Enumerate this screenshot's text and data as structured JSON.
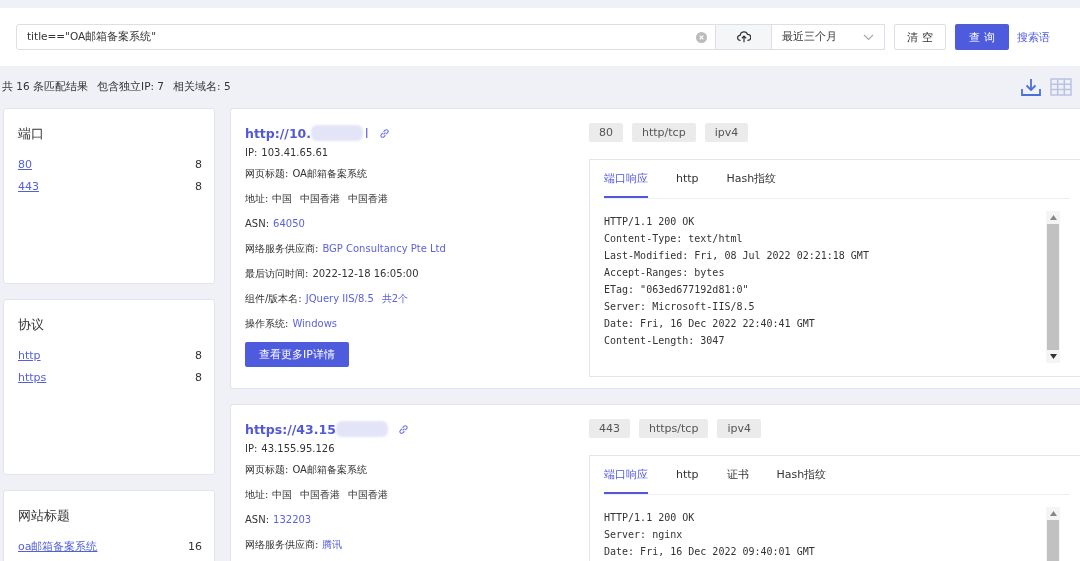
{
  "search": {
    "value": "title==\"OA邮箱备案系统\"",
    "time_range": "最近三个月",
    "clear_button": "清 空",
    "query_button": "查 询",
    "syntax_link": "搜索语"
  },
  "summary": [
    "共 16 条匹配结果",
    "包含独立IP: 7",
    "相关域名: 5"
  ],
  "filters": [
    {
      "title": "端口",
      "items": [
        {
          "label": "80",
          "count": "8"
        },
        {
          "label": "443",
          "count": "8"
        }
      ]
    },
    {
      "title": "协议",
      "items": [
        {
          "label": "http",
          "count": "8"
        },
        {
          "label": "https",
          "count": "8"
        }
      ]
    },
    {
      "title": "网站标题",
      "items": [
        {
          "label": "oa邮箱备案系统",
          "count": "16"
        }
      ]
    }
  ],
  "results": [
    {
      "url": "http://10.",
      "url_tail": "l",
      "fields": [
        {
          "label": "IP:",
          "values": [
            "103.41.65.61"
          ],
          "link": false
        },
        {
          "label": "网页标题:",
          "values": [
            "OA邮箱备案系统"
          ],
          "link": false
        },
        {
          "label": "地址:",
          "values": [
            "中国",
            "中国香港",
            "中国香港"
          ],
          "link": false
        },
        {
          "label": "ASN:",
          "values": [
            "64050"
          ],
          "link": true
        },
        {
          "label": "网络服务供应商:",
          "values": [
            "BGP Consultancy Pte Ltd"
          ],
          "link": true
        },
        {
          "label": "最后访问时间:",
          "values": [
            "2022-12-18 16:05:00"
          ],
          "link": false
        },
        {
          "label": "组件/版本名:",
          "values": [
            "JQuery IIS/8.5",
            "共2个"
          ],
          "link": true
        },
        {
          "label": "操作系统:",
          "values": [
            "Windows"
          ],
          "link": true
        }
      ],
      "button": "查看更多IP详情",
      "tags": [
        "80",
        "http/tcp",
        "ipv4"
      ],
      "tabs": [
        {
          "label": "端口响应",
          "selected": true
        },
        {
          "label": "http",
          "selected": false
        },
        {
          "label": "Hash指纹",
          "selected": false
        }
      ],
      "response": [
        "HTTP/1.1 200 OK",
        "Content-Type: text/html",
        "Last-Modified: Fri, 08 Jul 2022 02:21:18 GMT",
        "Accept-Ranges: bytes",
        "ETag: \"063ed677192d81:0\"",
        "Server: Microsoft-IIS/8.5",
        "Date: Fri, 16 Dec 2022 22:40:41 GMT",
        "Content-Length: 3047"
      ]
    },
    {
      "url": "https://43.15",
      "fields": [
        {
          "label": "IP:",
          "values": [
            "43.155.95.126"
          ],
          "link": false
        },
        {
          "label": "网页标题:",
          "values": [
            "OA邮箱备案系统"
          ],
          "link": false
        },
        {
          "label": "地址:",
          "values": [
            "中国",
            "中国香港",
            "中国香港"
          ],
          "link": false
        },
        {
          "label": "ASN:",
          "values": [
            "132203"
          ],
          "link": true
        },
        {
          "label": "网络服务供应商:",
          "values": [
            "腾讯"
          ],
          "link": true
        }
      ],
      "tags": [
        "443",
        "https/tcp",
        "ipv4"
      ],
      "tabs": [
        {
          "label": "端口响应",
          "selected": true
        },
        {
          "label": "http",
          "selected": false
        },
        {
          "label": "证书",
          "selected": false
        },
        {
          "label": "Hash指纹",
          "selected": false
        }
      ],
      "response": [
        "HTTP/1.1 200 OK",
        "Server: nginx",
        "Date: Fri, 16 Dec 2022 09:40:01 GMT"
      ]
    }
  ]
}
